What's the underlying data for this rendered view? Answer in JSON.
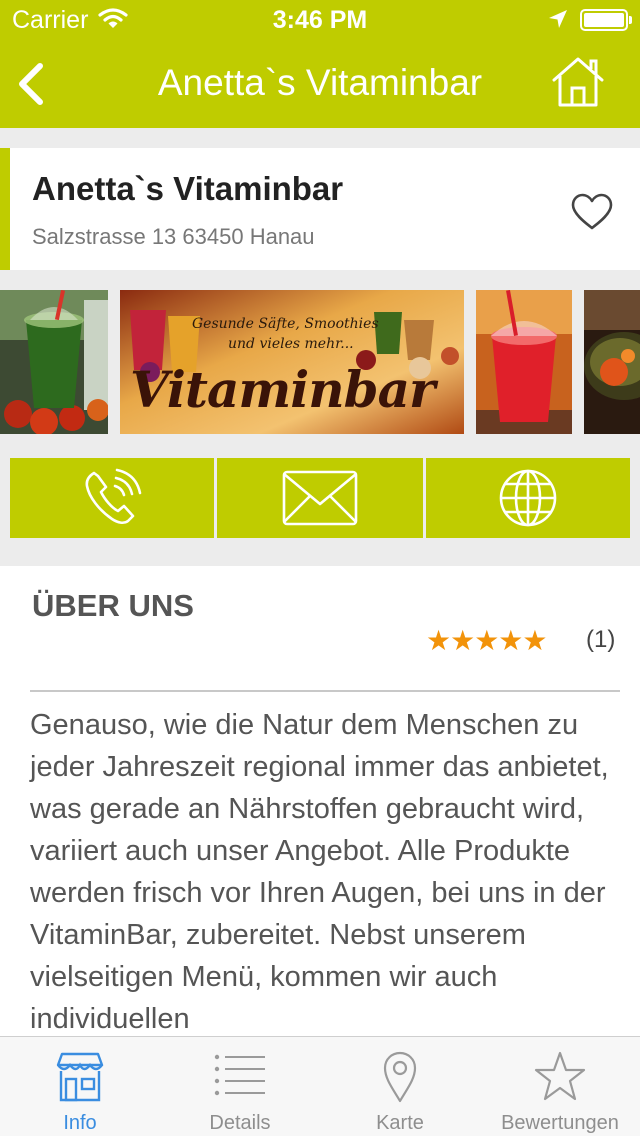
{
  "status_bar": {
    "carrier": "Carrier",
    "time": "3:46 PM"
  },
  "nav": {
    "title": "Anetta`s Vitaminbar"
  },
  "business": {
    "name": "Anetta`s Vitaminbar",
    "address": "Salzstrasse 13 63450 Hanau"
  },
  "gallery": {
    "banner_line1": "Gesunde Säfte, Smoothies",
    "banner_line2": "und vieles mehr...",
    "banner_logo": "Vitaminbar"
  },
  "actions": [
    "phone-icon",
    "mail-icon",
    "globe-icon"
  ],
  "about": {
    "heading": "ÜBER UNS",
    "stars": "★★★★★",
    "rating": 5,
    "review_count": "(1)",
    "text": "Genauso, wie die Natur dem Menschen zu jeder Jahreszeit regional immer das anbietet, was gerade an Nährstoffen gebraucht wird, variiert auch unser Angebot. Alle Produkte werden frisch vor Ihren Augen, bei uns in der VitaminBar, zubereitet. Nebst unserem vielseitigen Menü, kommen wir auch individuellen"
  },
  "tabs": [
    {
      "label": "Info",
      "icon": "store-icon",
      "active": true
    },
    {
      "label": "Details",
      "icon": "list-icon",
      "active": false
    },
    {
      "label": "Karte",
      "icon": "map-pin-icon",
      "active": false
    },
    {
      "label": "Bewertungen",
      "icon": "star-icon",
      "active": false
    }
  ],
  "colors": {
    "accent": "#bfcc00",
    "star": "#f2930a",
    "tab_active": "#3a8de0"
  }
}
